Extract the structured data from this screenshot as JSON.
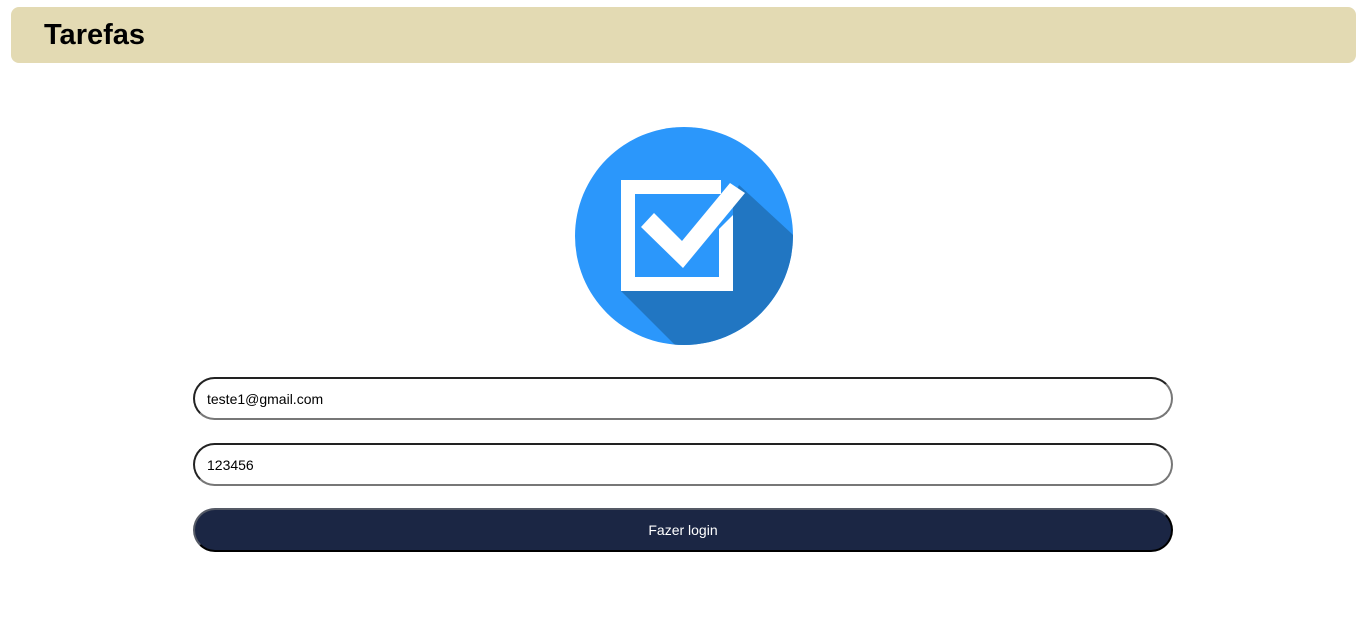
{
  "header": {
    "title": "Tarefas"
  },
  "logo": {
    "icon": "checkbox-check-icon",
    "colors": {
      "circle": "#2b97fb",
      "shadow": "#2176c2",
      "mark": "#ffffff"
    }
  },
  "form": {
    "email_value": "teste1@gmail.com",
    "password_value": "123456",
    "login_label": "Fazer login"
  },
  "colors": {
    "header_bg": "#e3dab3",
    "button_bg": "#1b2644"
  }
}
